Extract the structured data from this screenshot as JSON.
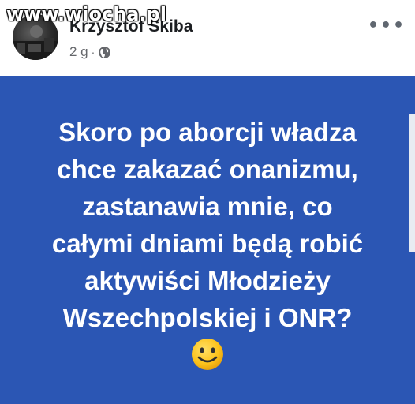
{
  "watermark": "www.wiocha.pl",
  "post_header": {
    "author": "Krzysztof Skiba",
    "time": "2 g",
    "separator": "·",
    "privacy_icon": "globe-icon",
    "more_icon": "more-options-icon",
    "more_label": "•••"
  },
  "post": {
    "background_color": "#2b56b4",
    "text_lines": [
      "Skoro po aborcji władza",
      "chce zakazać onanizmu,",
      "zastanawia mnie, co",
      "całymi dniami będą robić",
      "aktywiści Młodzieży",
      "Wszechpolskiej i ONR?"
    ],
    "emoji": "slightly-smiling-face-icon"
  }
}
